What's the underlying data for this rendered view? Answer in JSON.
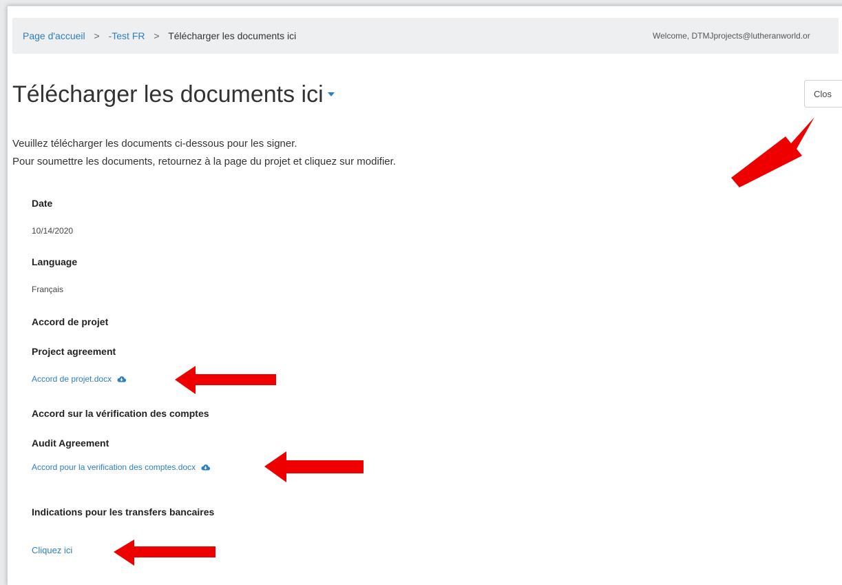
{
  "breadcrumb": {
    "home": "Page d'accueil",
    "separator": ">",
    "project": "-Test FR",
    "current": "Télécharger les documents ici"
  },
  "header": {
    "welcome": "Welcome, DTMJprojects@lutheranworld.or"
  },
  "page": {
    "title": "Télécharger les documents ici",
    "close_label": "Clos"
  },
  "intro": {
    "line1": "Veuillez télécharger les documents ci-dessous pour les signer.",
    "line2": "Pour soumettre les documents, retournez à la page du projet et cliquez sur modifier."
  },
  "fields": {
    "date_label": "Date",
    "date_value": "10/14/2020",
    "language_label": "Language",
    "language_value": "Français"
  },
  "documents": {
    "project_heading": "Accord de projet",
    "project_sublabel": "Project agreement",
    "project_file": "Accord de projet.docx",
    "audit_heading": "Accord sur la vérification des comptes",
    "audit_sublabel": "Audit Agreement",
    "audit_file": "Accord pour la verification des comptes.docx",
    "bank_heading": "Indications pour les transfers bancaires",
    "bank_link": "Cliquez ici"
  },
  "icons": {
    "download": "cloud-download-icon",
    "caret": "caret-down-icon",
    "arrow": "red-arrow-annotation"
  },
  "colors": {
    "link": "#2d7fbf",
    "arrow": "#ee0000",
    "topbar": "#eeeff0"
  }
}
